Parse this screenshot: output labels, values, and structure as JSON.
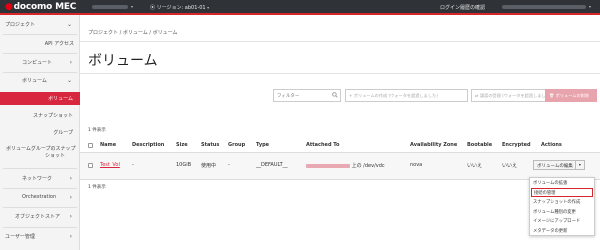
{
  "brand": {
    "mark": "●",
    "name": "docomo MEC"
  },
  "topbar": {
    "region_label": "リージョン: ab01-01",
    "login_history": "ログイン履歴の確認"
  },
  "sidebar": {
    "items": [
      {
        "label": "プロジェクト",
        "expand": "⌄"
      },
      {
        "label": "API アクセス"
      },
      {
        "label": "コンピュート",
        "expand": "›"
      },
      {
        "label": "ボリューム",
        "expand": "⌄"
      },
      {
        "label": "ボリューム"
      },
      {
        "label": "スナップショット"
      },
      {
        "label": "グループ"
      },
      {
        "label": "ボリュームグループのスナップ",
        "label2": "ショット"
      },
      {
        "label": "ネットワーク",
        "expand": "›"
      },
      {
        "label": "Orchestration",
        "expand": "›"
      },
      {
        "label": "オブジェクトストア",
        "expand": "›"
      },
      {
        "label": "ユーザー管理",
        "expand": "›"
      }
    ]
  },
  "main": {
    "breadcrumb": "プロジェクト / ボリューム / ボリューム",
    "title": "ボリューム",
    "filter_placeholder": "フィルター",
    "buttons": {
      "create": "+ ボリュームの作成 (ウォータを超過しました)",
      "transfer": "⇄ 譲渡の受理 (ウォータを超過しました)",
      "delete": "🗑 ボリュームの削除"
    },
    "count_top": "1 件表示",
    "count_bottom": "1 件表示",
    "columns": {
      "name": "Name",
      "description": "Description",
      "size": "Size",
      "status": "Status",
      "group": "Group",
      "type": "Type",
      "attached_to": "Attached To",
      "availability_zone": "Availability Zone",
      "bootable": "Bootable",
      "encrypted": "Encrypted",
      "actions": "Actions"
    },
    "rows": [
      {
        "name": "Test_Vol",
        "description": "-",
        "size": "10GiB",
        "status": "使用中",
        "group": "-",
        "type": "__DEFAULT__",
        "attached_suffix": "上の /dev/vdc",
        "availability_zone": "nova",
        "bootable": "いいえ",
        "encrypted": "いいえ",
        "action": "ボリュームの編集"
      }
    ],
    "dropdown": [
      "ボリュームの拡張",
      "接続の管理",
      "スナップショットの作成",
      "ボリューム種別の変更",
      "イメージにアップロード",
      "メタデータの更新"
    ]
  },
  "colors": {
    "accent": "#d7263d",
    "topbar": "#2f3338"
  }
}
